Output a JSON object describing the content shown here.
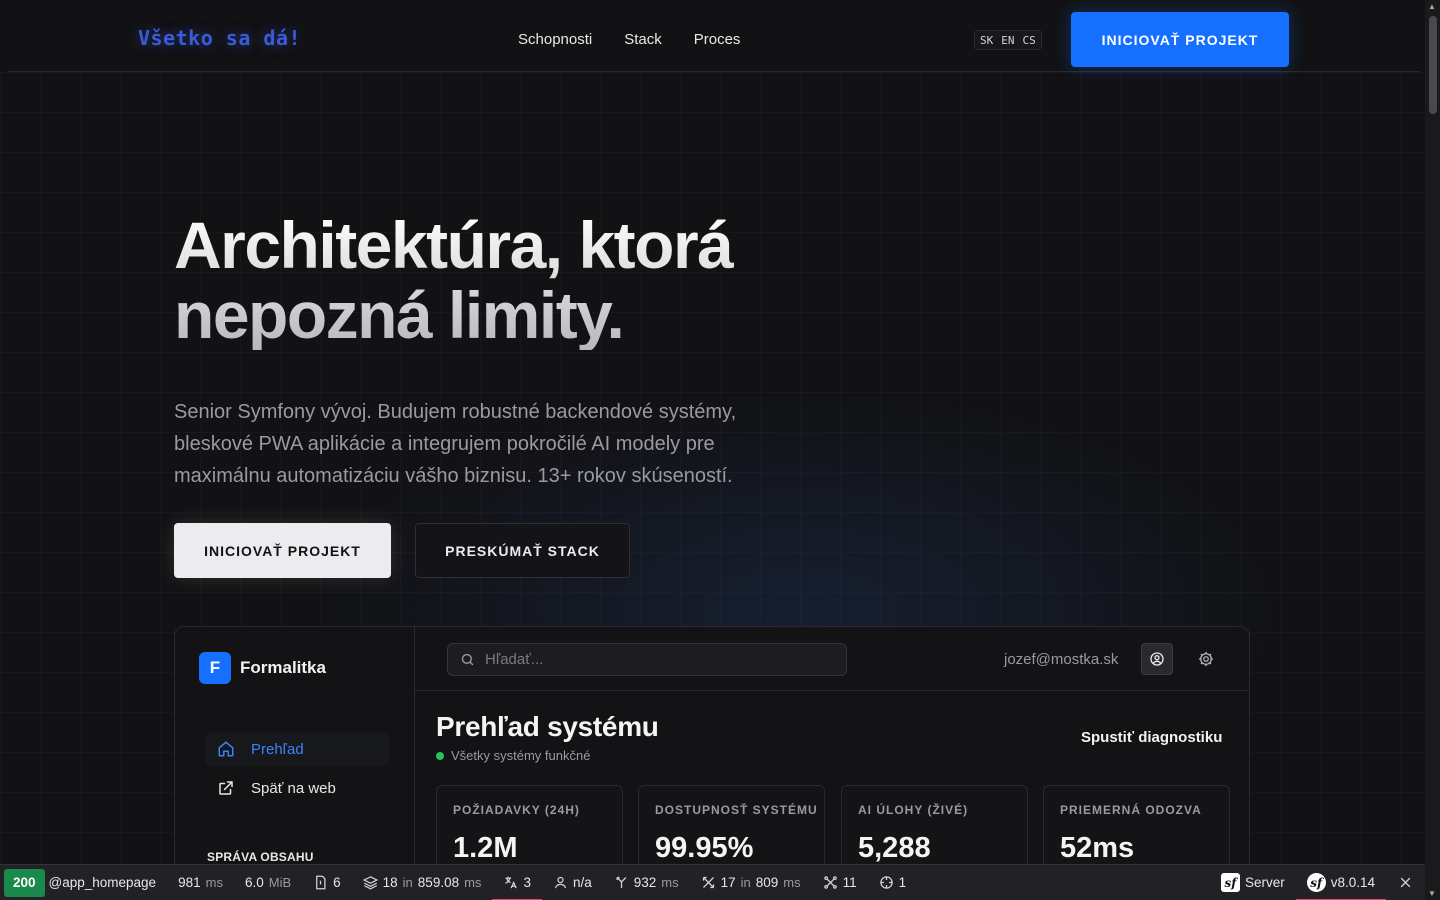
{
  "header": {
    "logo": "Všetko sa dá!",
    "nav": [
      "Schopnosti",
      "Stack",
      "Proces"
    ],
    "languages": [
      "SK",
      "EN",
      "CS"
    ],
    "cta_label": "INICIOVAŤ PROJEKT"
  },
  "hero": {
    "title_line1": "Architektúra, ktorá",
    "title_line2": "nepozná limity.",
    "subtitle": "Senior Symfony vývoj. Budujem robustné backendové systémy, bleskové PWA aplikácie a integrujem pokročilé AI modely pre maximálnu automatizáciu vášho biznisu. 13+ rokov skúseností.",
    "primary_button": "INICIOVAŤ PROJEKT",
    "secondary_button": "PRESKÚMAŤ STACK"
  },
  "dashboard": {
    "brand_initial": "F",
    "brand_name": "Formalitka",
    "sidebar": [
      {
        "label": "Prehľad",
        "icon": "home-icon",
        "active": true
      },
      {
        "label": "Späť na web",
        "icon": "external-link-icon",
        "active": false
      }
    ],
    "section_label": "SPRÁVA OBSAHU",
    "search_placeholder": "Hľadať...",
    "user_email": "jozef@mostka.sk",
    "page_title": "Prehľad systému",
    "status_text": "Všetky systémy funkčné",
    "status_color": "#22c55e",
    "diagnostics_label": "Spustiť diagnostiku",
    "stats": [
      {
        "label": "POŽIADAVKY (24H)",
        "value": "1.2M"
      },
      {
        "label": "DOSTUPNOSŤ SYSTÉMU",
        "value": "99.95%"
      },
      {
        "label": "AI ÚLOHY (ŽIVÉ)",
        "value": "5,288"
      },
      {
        "label": "PRIEMERNÁ ODOZVA",
        "value": "52ms"
      }
    ]
  },
  "debug_toolbar": {
    "status_code": "200",
    "route": "@app_homepage",
    "time_value": "981",
    "time_unit": "ms",
    "memory_value": "6.0",
    "memory_unit": "MiB",
    "forms": "6",
    "cache_count": "18",
    "cache_in": "in",
    "cache_time": "859.08",
    "cache_unit": "ms",
    "translations": "3",
    "user": "n/a",
    "events_time": "932",
    "events_unit": "ms",
    "http_count": "17",
    "http_in": "in",
    "http_time": "809",
    "http_unit": "ms",
    "workflows": "11",
    "exceptions": "1",
    "server_label": "Server",
    "version": "v8.0.14"
  },
  "colors": {
    "accent": "#1670ff",
    "background": "#121214",
    "logo": "#3b5bdb",
    "debug_ok": "#1a8a4c",
    "debug_highlight": "#e5436a"
  }
}
